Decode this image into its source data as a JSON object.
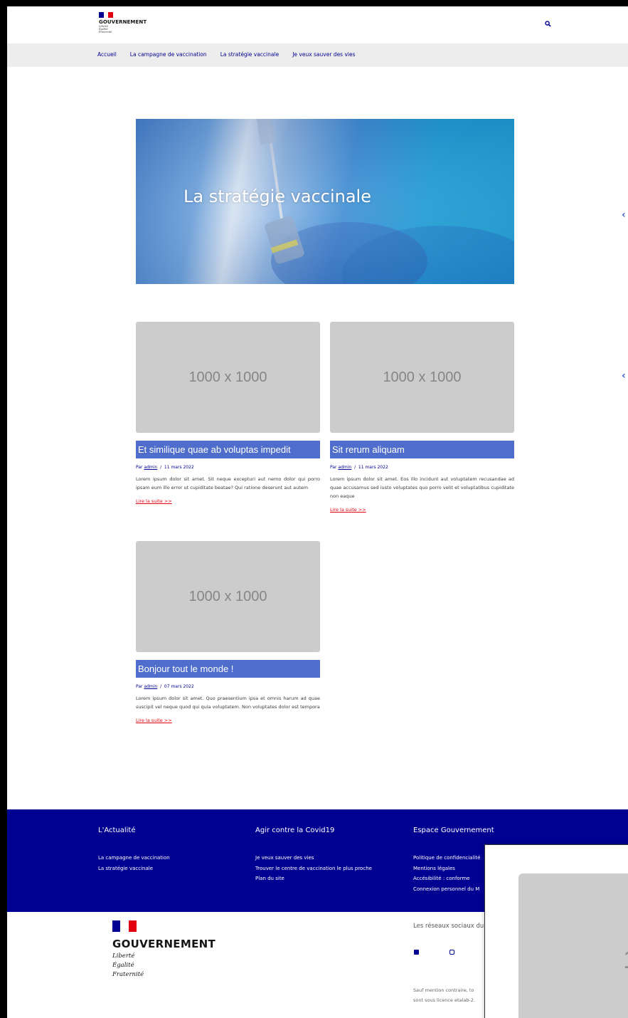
{
  "header": {
    "brand": "GOUVERNEMENT",
    "motto": [
      "Liberté",
      "Égalité",
      "Fraternité"
    ],
    "search_icon": "search-icon"
  },
  "nav": {
    "items": [
      "Accueil",
      "La campagne de vaccination",
      "La stratégie vaccinale",
      "Je veux sauver des vies"
    ]
  },
  "hero": {
    "title": "La stratégie vaccinale"
  },
  "cards": [
    {
      "thumb": "1000 x 1000",
      "title": "Et similique quae ab voluptas impedit",
      "by": "Par",
      "author": "admin",
      "sep": "/",
      "date": "11 mars 2022",
      "excerpt": "Lorem ipsum dolor sit amet. Sit neque excepturi aut nemo dolor qui porro ipsam eum illo error ut cupiditate beatae? Qui ratione deserunt aut autem",
      "more": "Lire la suite >>"
    },
    {
      "thumb": "1000 x 1000",
      "title": "Sit rerum aliquam",
      "by": "Par",
      "author": "admin",
      "sep": "/",
      "date": "11 mars 2022",
      "excerpt": "Lorem ipsum dolor sit amet. Eos illo incidunt aut voluptatem recusandae ad quae accusamus sed iusto voluptates quo porro velit et voluptatibus cupiditate non eaque",
      "more": "Lire la suite >>"
    },
    {
      "thumb": "1000 x 1000",
      "title": "Bonjour tout le monde !",
      "by": "Par",
      "author": "admin",
      "sep": "/",
      "date": "07 mars 2022",
      "excerpt": "Lorem ipsum dolor sit amet. Quo praesentium ipsa et omnis harum ad quae suscipit vel neque quod qui quia voluptatem. Non voluptates dolor est tempora",
      "more": "Lire la suite >>"
    }
  ],
  "footer": {
    "columns": [
      {
        "head": "L'Actualité",
        "links": [
          "La campagne de vaccination",
          "La stratégie vaccinale"
        ]
      },
      {
        "head": "Agir contre la Covid19",
        "links": [
          "Je veux sauver des vies",
          "Trouver le centre de vaccination le plus proche",
          "Plan du site"
        ]
      },
      {
        "head": "Espace Gouvernement",
        "links": [
          "Politique de confidencialité",
          "Mentions légales",
          "Accésibilité : conforme",
          "Connexion personnel du M"
        ]
      }
    ],
    "brand": "GOUVERNEMENT",
    "motto": [
      "Liberté",
      "Égalité",
      "Fraternité"
    ],
    "social_head": "Les réseaux sociaux du",
    "license": [
      "Sauf mention contraire, to",
      "sont sous licence etalab-2."
    ]
  },
  "popup": {
    "thumb_text": "1"
  },
  "colors": {
    "primary": "#000091",
    "accent_red": "#e1000f",
    "card_title_bg": "#4f6ecc",
    "nav_bg": "#ededed"
  }
}
